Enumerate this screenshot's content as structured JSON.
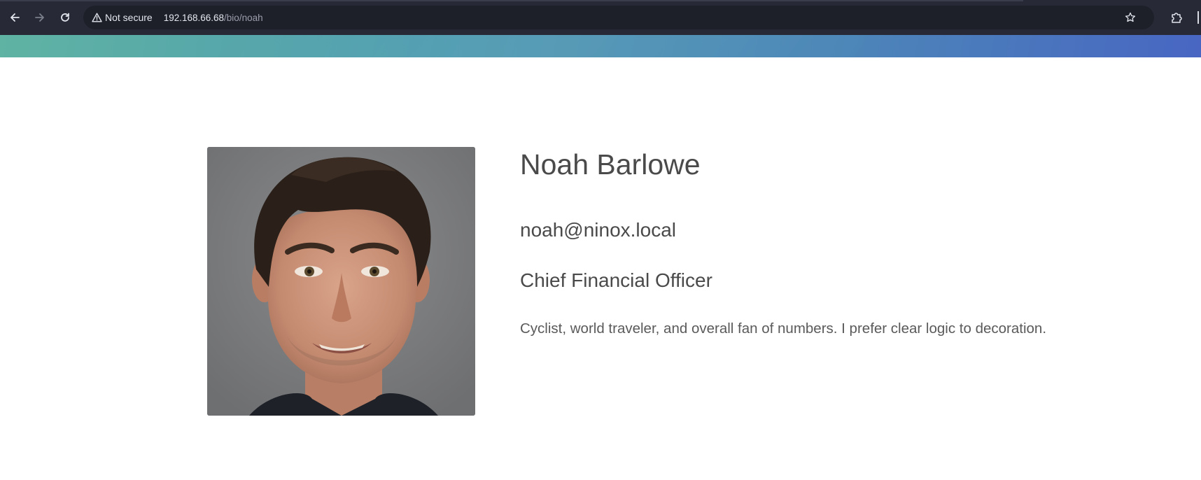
{
  "browser": {
    "security_label": "Not secure",
    "url_host": "192.168.66.68",
    "url_path": "/bio/noah",
    "icons": {
      "back": "back-arrow-icon",
      "forward": "forward-arrow-icon",
      "reload": "reload-icon",
      "security": "warning-triangle-icon",
      "bookmark": "star-icon",
      "extensions": "puzzle-icon"
    }
  },
  "profile": {
    "name": "Noah Barlowe",
    "email": "noah@ninox.local",
    "title": "Chief Financial Officer",
    "bio": "Cyclist, world traveler, and overall fan of numbers. I prefer clear logic to decoration.",
    "photo_alt": "Noah Barlowe"
  },
  "colors": {
    "banner_start": "#5fb3a3",
    "banner_end": "#4866c2",
    "text": "#4a4a4a",
    "chrome_bg": "#272a36"
  }
}
